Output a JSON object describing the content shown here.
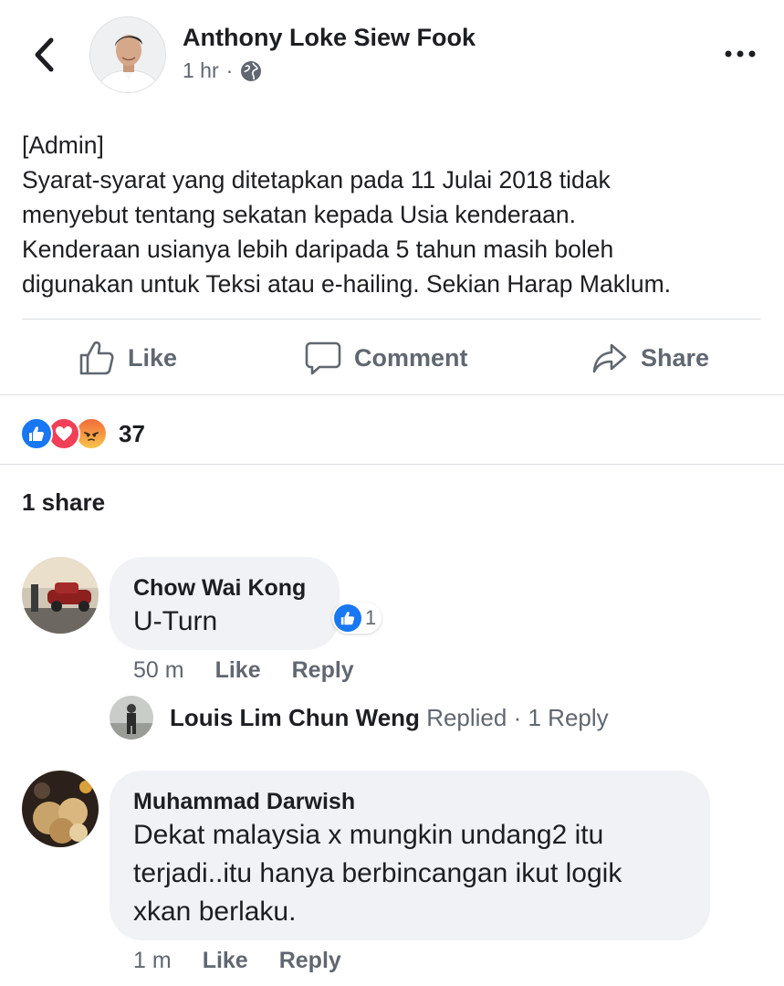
{
  "post": {
    "author": "Anthony Loke Siew Fook",
    "time": "1 hr",
    "separator": "·",
    "privacy_icon": "globe-icon",
    "text_lines": [
      "[Admin]",
      "Syarat-syarat yang ditetapkan pada 11 Julai 2018 tidak",
      "menyebut tentang sekatan kepada Usia kenderaan.",
      "Kenderaan usianya lebih daripada 5 tahun masih boleh",
      "digunakan untuk Teksi atau e-hailing. Sekian Harap Maklum."
    ]
  },
  "actions": {
    "like": "Like",
    "comment": "Comment",
    "share": "Share"
  },
  "reactions": {
    "types": [
      "like",
      "love",
      "angry"
    ],
    "count": "37"
  },
  "shares": "1 share",
  "comments": [
    {
      "name": "Chow Wai Kong",
      "text": "U-Turn",
      "time": "50 m",
      "like": "Like",
      "reply": "Reply",
      "reaction_count": "1",
      "replies": {
        "name": "Louis Lim Chun Weng",
        "label": "Replied",
        "separator": "·",
        "count": "1 Reply"
      }
    },
    {
      "name": "Muhammad Darwish",
      "text_lines": [
        "Dekat malaysia x mungkin undang2 itu",
        "terjadi..itu hanya berbincangan ikut logik",
        "xkan berlaku."
      ],
      "time": "1 m",
      "like": "Like",
      "reply": "Reply"
    }
  ],
  "colors": {
    "text": "#1c1e21",
    "secondary": "#606770",
    "bubble": "#f0f2f5",
    "like_blue": "#1877f2",
    "love_red": "#f33e58"
  }
}
